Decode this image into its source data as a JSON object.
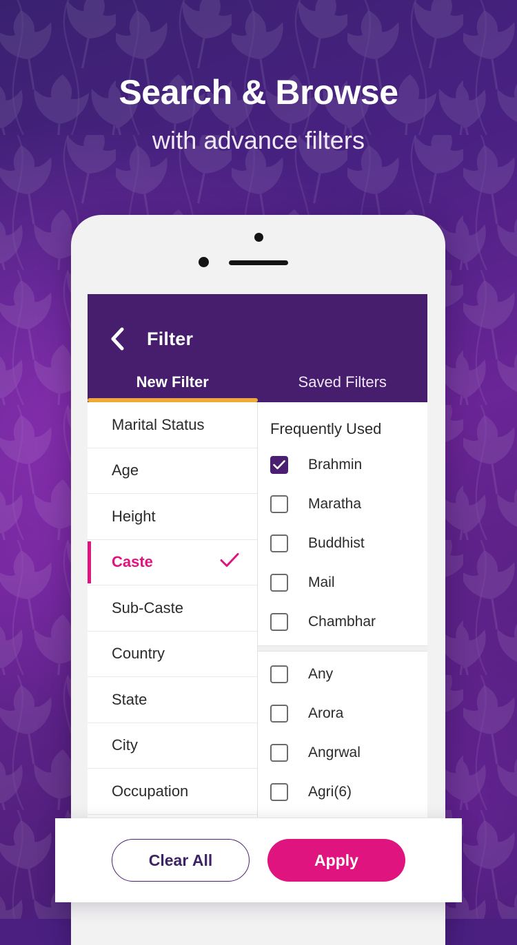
{
  "promo": {
    "headline": "Search & Browse",
    "subheadline": "with advance filters"
  },
  "colors": {
    "header_purple": "#471e6e",
    "accent_pink": "#e0147f",
    "tab_indicator_orange": "#f0a838",
    "checkbox_checked": "#4a1e70",
    "background_purple": "#4a2183"
  },
  "appbar": {
    "back_icon": "chevron-left-icon",
    "title": "Filter",
    "tabs": [
      {
        "label": "New Filter",
        "active": true
      },
      {
        "label": "Saved Filters",
        "active": false
      }
    ]
  },
  "filter_list": [
    {
      "label": "Marital Status",
      "selected": false
    },
    {
      "label": "Age",
      "selected": false
    },
    {
      "label": "Height",
      "selected": false
    },
    {
      "label": "Caste",
      "selected": true,
      "check_icon": "check-icon"
    },
    {
      "label": "Sub-Caste",
      "selected": false
    },
    {
      "label": "Country",
      "selected": false
    },
    {
      "label": "State",
      "selected": false
    },
    {
      "label": "City",
      "selected": false
    },
    {
      "label": "Occupation",
      "selected": false
    }
  ],
  "options_panel": {
    "section_title": "Frequently Used",
    "frequently_used": [
      {
        "label": "Brahmin",
        "checked": true
      },
      {
        "label": "Maratha",
        "checked": false
      },
      {
        "label": "Buddhist",
        "checked": false
      },
      {
        "label": "Mail",
        "checked": false
      },
      {
        "label": "Chambhar",
        "checked": false
      }
    ],
    "all_options": [
      {
        "label": "Any",
        "checked": false
      },
      {
        "label": "Arora",
        "checked": false
      },
      {
        "label": "Angrwal",
        "checked": false
      },
      {
        "label": "Agri(6)",
        "checked": false
      }
    ]
  },
  "actions": {
    "clear_label": "Clear All",
    "apply_label": "Apply"
  }
}
